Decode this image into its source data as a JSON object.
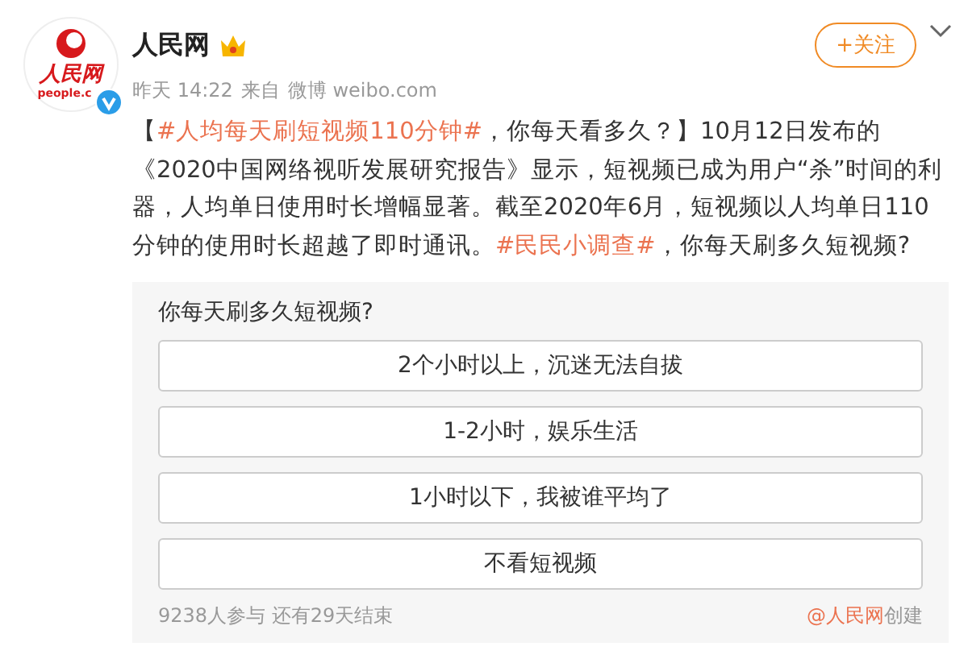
{
  "post": {
    "author": "人民网",
    "avatar_text": [
      "人民网",
      "people.c"
    ],
    "follow_button": "+关注",
    "time": "昨天 14:22",
    "source_prefix": "来自",
    "source": "微博 weibo.com",
    "body": [
      {
        "kind": "text",
        "text": "【"
      },
      {
        "kind": "topic",
        "text": "#人均每天刷短视频110分钟#"
      },
      {
        "kind": "text",
        "text": "，你每天看多久？】10月12日发布的《2020中国网络视听发展研究报告》显示，短视频已成为用户“杀”时间的利器，人均单日使用时长增幅显著。截至2020年6月，短视频以人均单日110分钟的使用时长超越了即时通讯。"
      },
      {
        "kind": "topic",
        "text": "#民民小调查#"
      },
      {
        "kind": "text",
        "text": "，你每天刷多久短视频?"
      }
    ]
  },
  "poll": {
    "question": "你每天刷多久短视频?",
    "options": [
      "2个小时以上，沉迷无法自拔",
      "1-2小时，娱乐生活",
      "1小时以下，我被谁平均了",
      "不看短视频"
    ],
    "stats": "9238人参与 还有29天结束",
    "creator": "@人民网",
    "creator_suffix": "创建"
  }
}
